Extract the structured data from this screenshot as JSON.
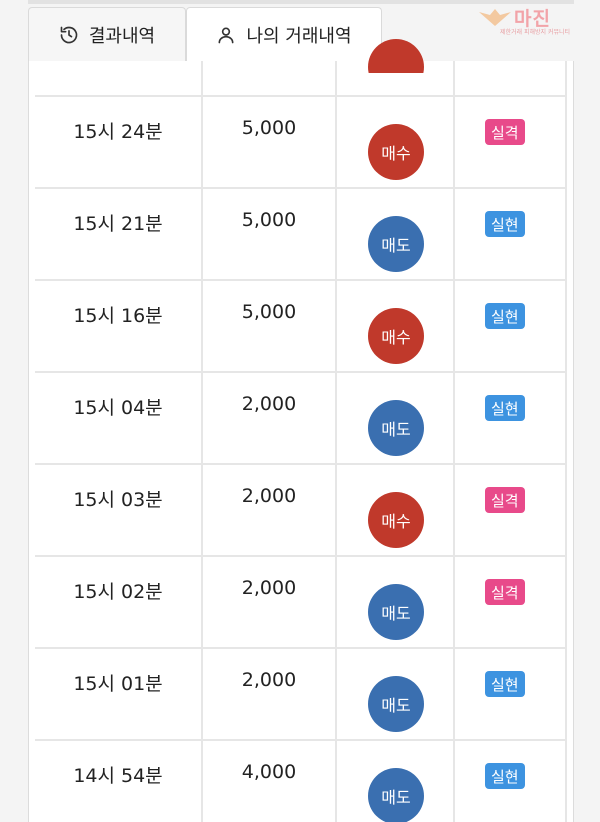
{
  "tabs": [
    {
      "label": "결과내역",
      "icon": "history-icon"
    },
    {
      "label": "나의 거래내역",
      "icon": "user-icon"
    }
  ],
  "watermark": {
    "title": "마진",
    "sub": "제한거래 피해방지 커뮤니티"
  },
  "colors": {
    "buy": "#c0392b",
    "sell": "#3a6fb0",
    "fail": "#e84a8a",
    "success": "#3d93e0"
  },
  "rows": [
    {
      "time": "15시 24분",
      "amount": "5,000",
      "side": "매수",
      "result": "실격"
    },
    {
      "time": "15시 21분",
      "amount": "5,000",
      "side": "매도",
      "result": "실현"
    },
    {
      "time": "15시 16분",
      "amount": "5,000",
      "side": "매수",
      "result": "실현"
    },
    {
      "time": "15시 04분",
      "amount": "2,000",
      "side": "매도",
      "result": "실현"
    },
    {
      "time": "15시 03분",
      "amount": "2,000",
      "side": "매수",
      "result": "실격"
    },
    {
      "time": "15시 02분",
      "amount": "2,000",
      "side": "매도",
      "result": "실격"
    },
    {
      "time": "15시 01분",
      "amount": "2,000",
      "side": "매도",
      "result": "실현"
    },
    {
      "time": "14시 54분",
      "amount": "4,000",
      "side": "매도",
      "result": "실현"
    }
  ]
}
